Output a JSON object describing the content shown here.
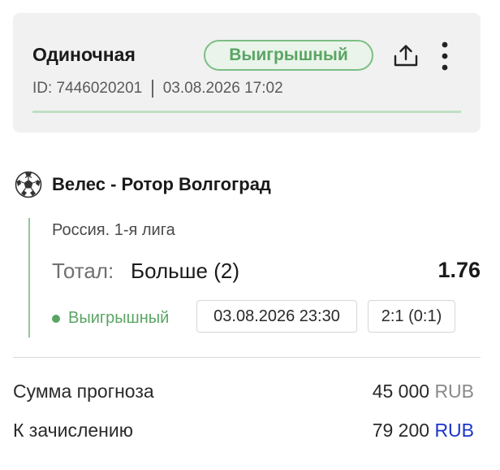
{
  "header": {
    "bet_type": "Одиночная",
    "status": "Выигрышный",
    "id_text": "ID: 7446020201",
    "datetime": "03.08.2026 17:02",
    "icons": {
      "share": "share-icon",
      "more": "more-vertical-icon"
    }
  },
  "event": {
    "sport_icon": "soccer-ball-icon",
    "title": "Велес - Ротор Волгоград",
    "league": "Россия. 1-я лига",
    "market_label": "Тотал:",
    "market_value": "Больше (2)",
    "odds": "1.76",
    "result_status": "Выигрышный",
    "match_datetime": "03.08.2026 23:30",
    "score": "2:1 (0:1)"
  },
  "summary": {
    "stake_label": "Сумма прогноза",
    "stake_amount": "45 000",
    "stake_currency": "RUB",
    "payout_label": "К зачислению",
    "payout_amount": "79 200",
    "payout_currency": "RUB"
  },
  "colors": {
    "win_green": "#5aa564",
    "card_bg": "#f1f1f1",
    "currency_blue": "#1a35c9"
  }
}
